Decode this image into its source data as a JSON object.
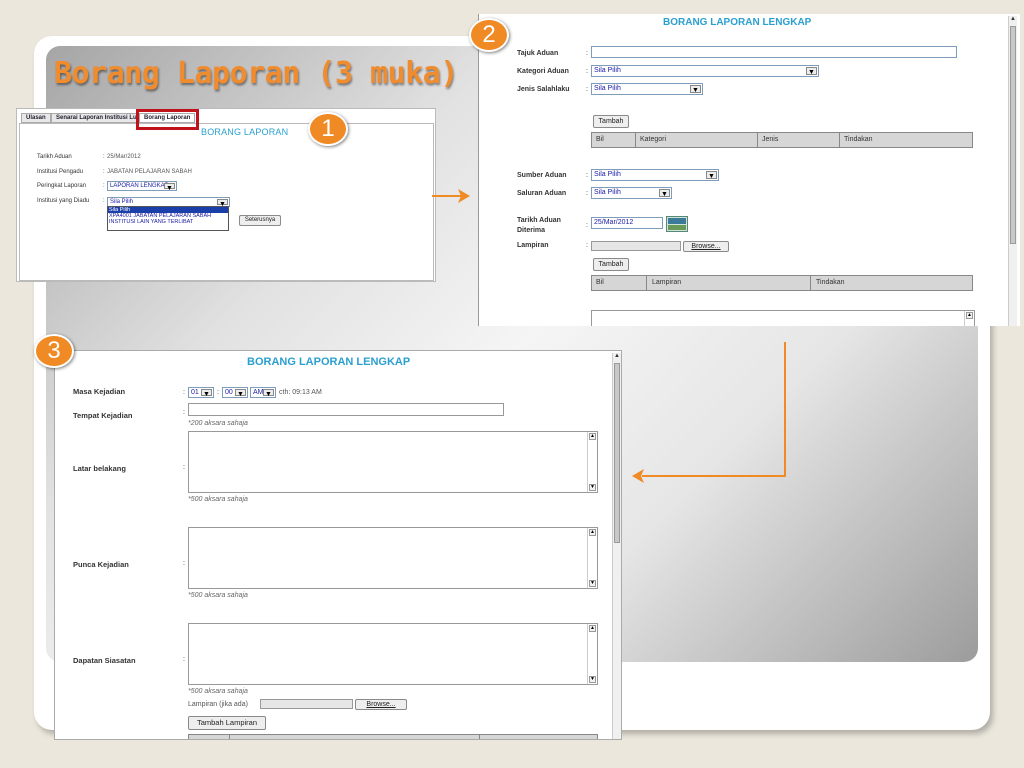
{
  "slide": {
    "title": "Borang Laporan (3 muka)"
  },
  "badges": [
    "1",
    "2",
    "3"
  ],
  "panel1": {
    "tabs": [
      "Ulasan",
      "Senarai Laporan Institusi Luar",
      "Borang Laporan"
    ],
    "title": "BORANG LAPORAN",
    "fields": [
      {
        "label": "Tarikh Aduan",
        "value": "25/Mar/2012"
      },
      {
        "label": "Institusi Pengadu",
        "value": "JABATAN PELAJARAN SABAH"
      },
      {
        "label": "Peringkat Laporan",
        "value": "LAPORAN LENGKAP"
      },
      {
        "label": "Institusi yang Diadu",
        "value": "Sila Pilih"
      }
    ],
    "dropdown_options": [
      "Sila Pilih",
      "XPA4001 JABATAN PELAJARAN SABAH",
      "INSTITUSI LAIN YANG TERLIBAT"
    ],
    "next_button": "Seterusnya"
  },
  "panel2": {
    "title": "BORANG LAPORAN LENGKAP",
    "fields": {
      "tajuk": "Tajuk Aduan",
      "kategori": "Kategori Aduan",
      "jenis": "Jenis Salahlaku",
      "sumber": "Sumber Aduan",
      "saluran": "Saluran Aduan",
      "tarikh": "Tarikh Aduan Diterima",
      "lampiran": "Lampiran"
    },
    "select_default": "Sila Pilih",
    "date_value": "25/Mar/2012",
    "add_button": "Tambah",
    "browse_button": "Browse...",
    "table1_headers": [
      "Bil",
      "Kategori",
      "Jenis",
      "Tindakan"
    ],
    "table2_headers": [
      "Bil",
      "Lampiran",
      "Tindakan"
    ]
  },
  "panel3": {
    "title": "BORANG LAPORAN LENGKAP",
    "masa_label": "Masa Kejadian",
    "hour": "01",
    "minute": "00",
    "ampm": "AM",
    "time_note": "cth: 09:13 AM",
    "tempat_label": "Tempat Kejadian",
    "hint_200": "*200 aksara sahaja",
    "latar_label": "Latar belakang",
    "punca_label": "Punca Kejadian",
    "dapatan_label": "Dapatan Siasatan",
    "hint_500": "*500 aksara sahaja",
    "lampiran_label": "Lampiran (jika ada)",
    "browse_button": "Browse...",
    "add_attachment_button": "Tambah Lampiran"
  },
  "colors": {
    "accent": "#f08a24",
    "title_blue": "#2a9fd0",
    "highlight_red": "#c0121a"
  }
}
